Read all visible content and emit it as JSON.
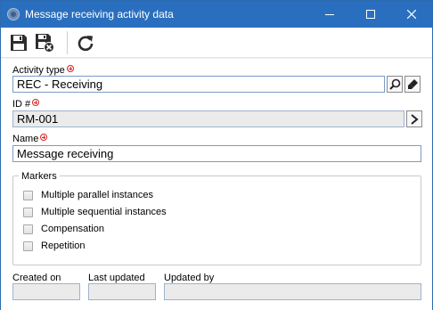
{
  "window": {
    "title": "Message receiving activity data",
    "icon": "app-globe-icon"
  },
  "toolbar": {
    "save_icon": "save-icon",
    "save_close_icon": "save-and-close-icon",
    "refresh_icon": "refresh-icon"
  },
  "form": {
    "activity_type_label": "Activity type",
    "activity_type_value": "REC - Receiving",
    "id_label": "ID #",
    "id_value": "RM-001",
    "name_label": "Name",
    "name_value": "Message receiving"
  },
  "markers": {
    "title": "Markers",
    "items": [
      {
        "label": "Multiple parallel instances",
        "checked": false
      },
      {
        "label": "Multiple sequential instances",
        "checked": false
      },
      {
        "label": "Compensation",
        "checked": false
      },
      {
        "label": "Repetition",
        "checked": false
      }
    ]
  },
  "footer": {
    "created_on_label": "Created on",
    "created_on_value": "",
    "last_updated_label": "Last updated",
    "last_updated_value": "",
    "updated_by_label": "Updated by",
    "updated_by_value": ""
  },
  "colors": {
    "titlebar": "#2a6fbf",
    "required": "#d22222",
    "field_border": "#7a9cc6"
  }
}
